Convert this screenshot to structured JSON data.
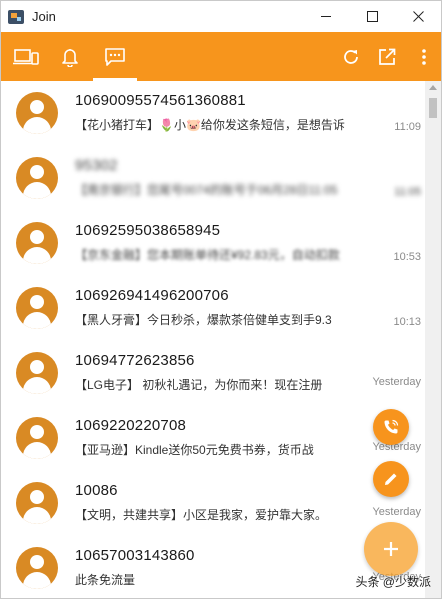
{
  "window": {
    "title": "Join",
    "accent_color": "#f7951c"
  },
  "toolbar": {
    "tabs": [
      {
        "name": "devices",
        "icon": "devices-icon"
      },
      {
        "name": "notifications",
        "icon": "bell-icon"
      },
      {
        "name": "sms",
        "icon": "message-icon",
        "selected": true
      }
    ],
    "actions": [
      {
        "name": "refresh",
        "icon": "refresh-icon"
      },
      {
        "name": "open-external",
        "icon": "open-external-icon"
      },
      {
        "name": "more",
        "icon": "more-vertical-icon"
      }
    ]
  },
  "messages": [
    {
      "sender": "10690095574561360881",
      "preview": "【花小猪打车】🌷小🐷给你发这条短信，是想告诉",
      "time": "11:09"
    },
    {
      "sender": "95302",
      "preview": "【南京银行】您尾号0074的账号于06月28日11:05",
      "time": "11:05"
    },
    {
      "sender": "10692595038658945",
      "preview": "【京东金融】您本期账单待还¥92.83元，自动扣款",
      "time": "10:53"
    },
    {
      "sender": "106926941496200706",
      "preview": "【黑人牙膏】今日秒杀，爆款茶倍健单支到手9.3",
      "time": "10:13"
    },
    {
      "sender": "10694772623856",
      "preview": "【LG电子】 初秋礼遇记，为你而来！现在注册",
      "time": "Yesterday"
    },
    {
      "sender": "1069220220708",
      "preview": "【亚马逊】Kindle送你50元免费书券，货币战",
      "time": "Yesterday"
    },
    {
      "sender": "10086",
      "preview": "【文明，共建共享】小区是我家，爱护靠大家。",
      "time": "Yesterday"
    },
    {
      "sender": "10657003143860",
      "preview": "此条免流量",
      "time": "Yesterday"
    }
  ],
  "fabs": {
    "call": "phone-icon",
    "edit": "pencil-icon",
    "add": "plus-icon"
  },
  "watermark": "头条 @少数派"
}
